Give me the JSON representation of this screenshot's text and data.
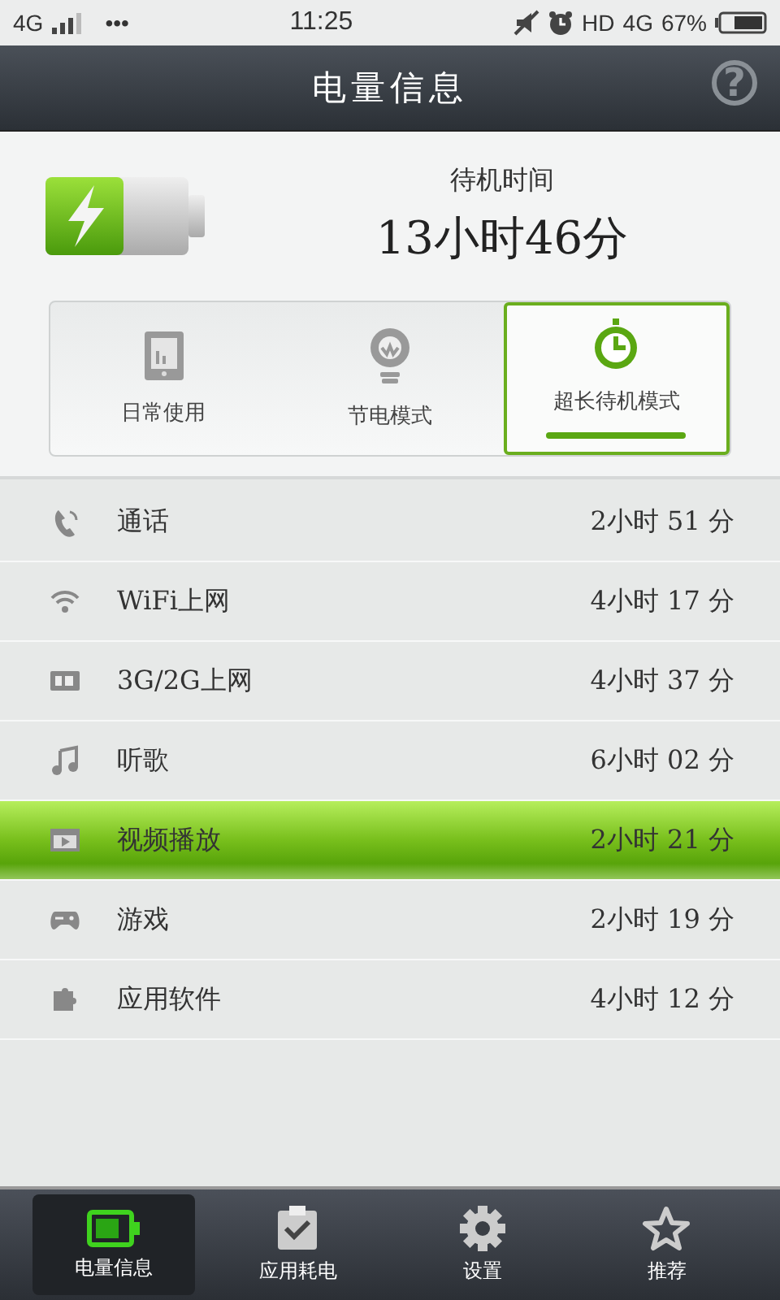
{
  "status_bar": {
    "network": "4G",
    "dots": "•••",
    "time": "11:25",
    "hd": "HD",
    "data": "4G",
    "battery": "67%"
  },
  "header": {
    "title": "电量信息",
    "help": "?"
  },
  "standby": {
    "label": "待机时间",
    "value": "13小时46分"
  },
  "modes": [
    {
      "label": "日常使用",
      "selected": false
    },
    {
      "label": "节电模式",
      "selected": false
    },
    {
      "label": "超长待机模式",
      "selected": true
    }
  ],
  "usage": [
    {
      "name": "通话",
      "time": "2小时 51 分",
      "selected": false
    },
    {
      "name": "WiFi上网",
      "time": "4小时 17 分",
      "selected": false
    },
    {
      "name": "3G/2G上网",
      "time": "4小时 37 分",
      "selected": false
    },
    {
      "name": "听歌",
      "time": "6小时 02 分",
      "selected": false
    },
    {
      "name": "视频播放",
      "time": "2小时 21 分",
      "selected": true
    },
    {
      "name": "游戏",
      "time": "2小时 19 分",
      "selected": false
    },
    {
      "name": "应用软件",
      "time": "4小时 12 分",
      "selected": false
    }
  ],
  "nav": [
    {
      "label": "电量信息",
      "selected": true
    },
    {
      "label": "应用耗电",
      "selected": false
    },
    {
      "label": "设置",
      "selected": false
    },
    {
      "label": "推荐",
      "selected": false
    }
  ]
}
